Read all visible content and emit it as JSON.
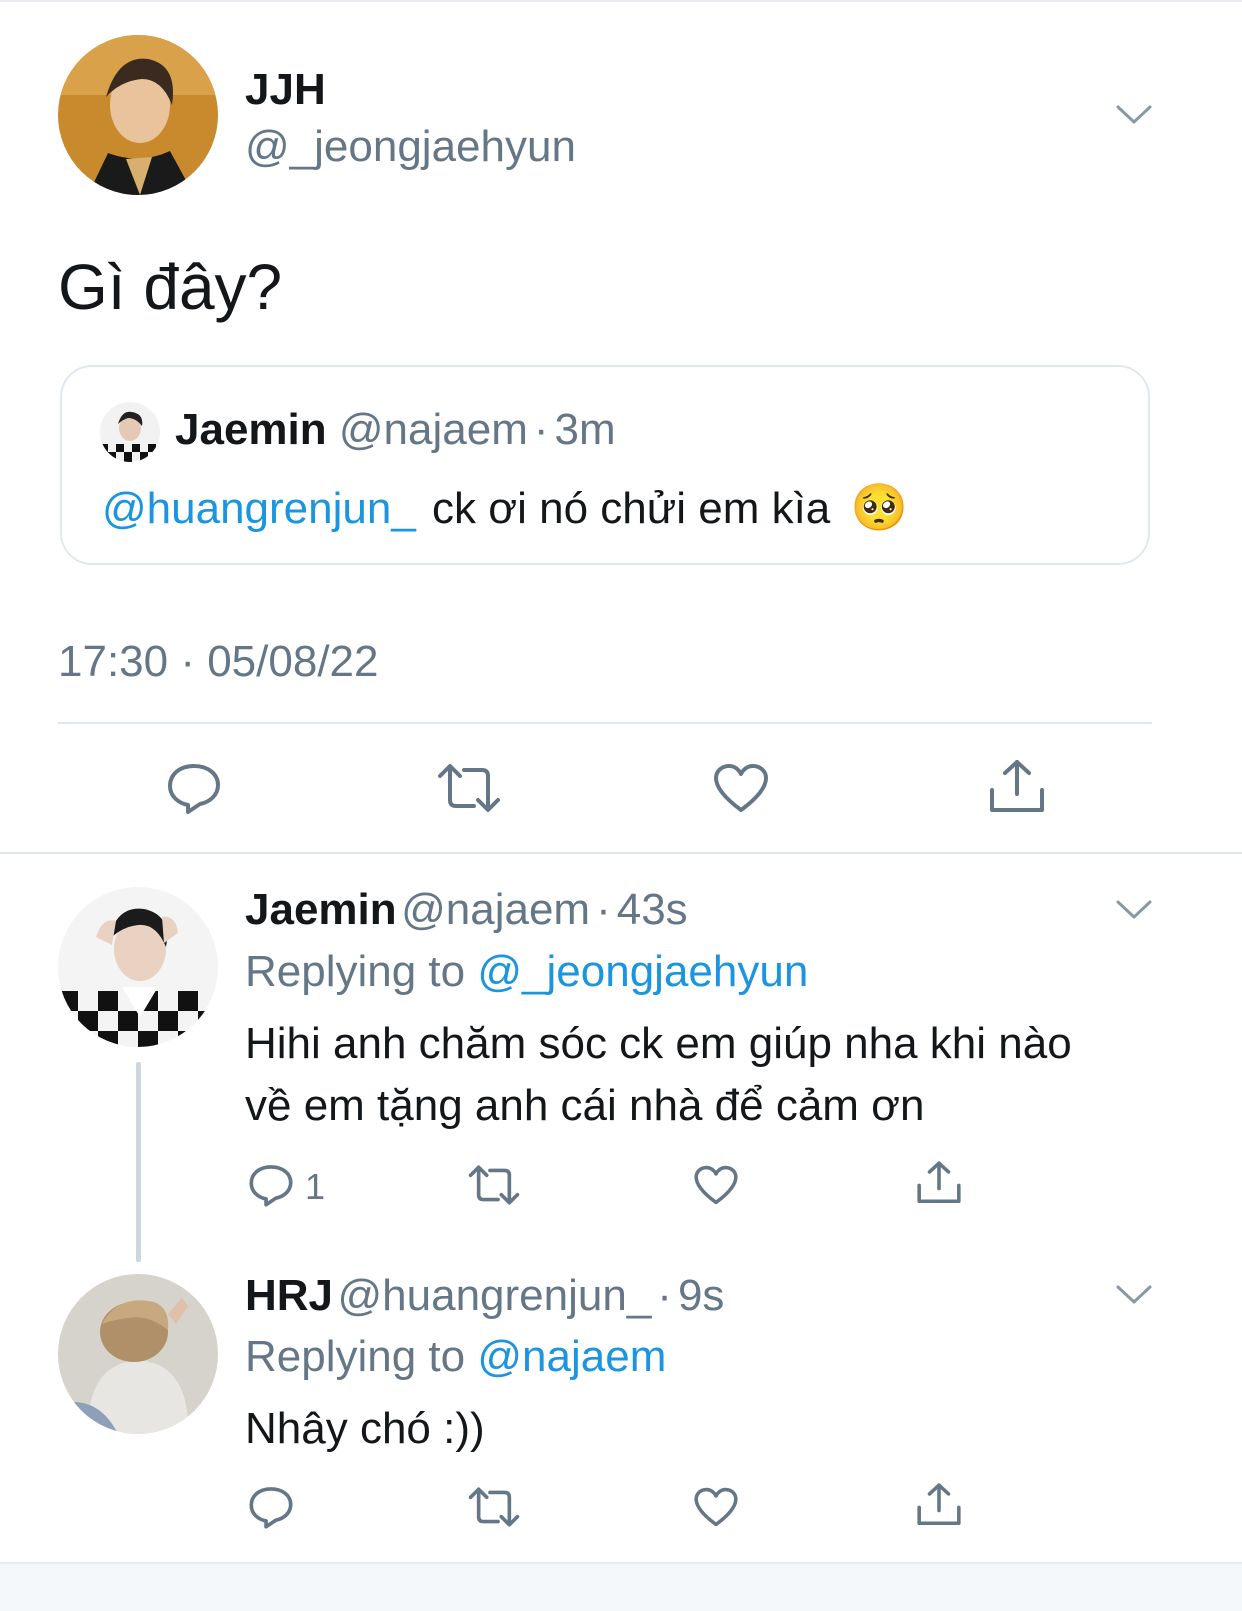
{
  "main_tweet": {
    "name": "JJH",
    "handle": "@_jeongjaehyun",
    "text": "Gì đây?",
    "timestamp": "17:30 · 05/08/22",
    "quoted": {
      "name": "Jaemin",
      "handle": "@najaem",
      "dot": "·",
      "time": "3m",
      "mention": "@huangrenjun_",
      "text": "ck ơi nó chửi em kìa",
      "emoji": "🥺"
    }
  },
  "replies": [
    {
      "name": "Jaemin",
      "handle": "@najaem",
      "dot": "·",
      "time": "43s",
      "replying_label": "Replying to",
      "replying_to": "@_jeongjaehyun",
      "text_line1": "Hihi anh chăm sóc ck em giúp nha khi nào",
      "text_line2": "về em tặng anh cái nhà để cảm ơn",
      "reply_count": "1"
    },
    {
      "name": "HRJ",
      "handle": "@huangrenjun_",
      "dot": "·",
      "time": "9s",
      "replying_label": "Replying to",
      "replying_to": "@najaem",
      "text": "Nhây chó :))"
    }
  ],
  "colors": {
    "link": "#1b95e0",
    "secondary": "#657786",
    "divider": "#e1e8ed"
  },
  "icons": [
    "chevron-down-icon",
    "reply-icon",
    "retweet-icon",
    "like-icon",
    "share-icon"
  ]
}
